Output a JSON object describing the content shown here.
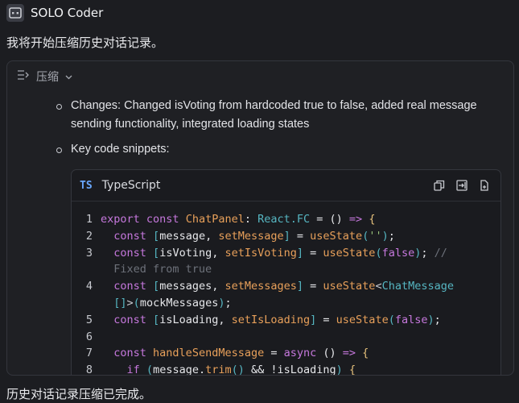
{
  "header": {
    "title": "SOLO Coder",
    "icon": "robot-icon"
  },
  "messages": {
    "intro": "我将开始压缩历史对话记录。",
    "done": "历史对话记录压缩已完成。"
  },
  "panel": {
    "label": "压缩",
    "bullets": [
      "Changes: Changed isVoting from hardcoded true to false, added real message sending functionality, integrated loading states",
      "Key code snippets:"
    ]
  },
  "code_block": {
    "badge": "TS",
    "language": "TypeScript",
    "line_numbers": [
      "1",
      "2",
      "3",
      "",
      "4",
      "",
      "5",
      "6",
      "7",
      "8"
    ]
  },
  "colors": {
    "background": "#1c1d21",
    "keyword": "#c678dd",
    "function": "#e8a05a",
    "type": "#56b6c2",
    "string": "#98c379",
    "comment": "#6d717a",
    "badge": "#6aa8ff"
  }
}
